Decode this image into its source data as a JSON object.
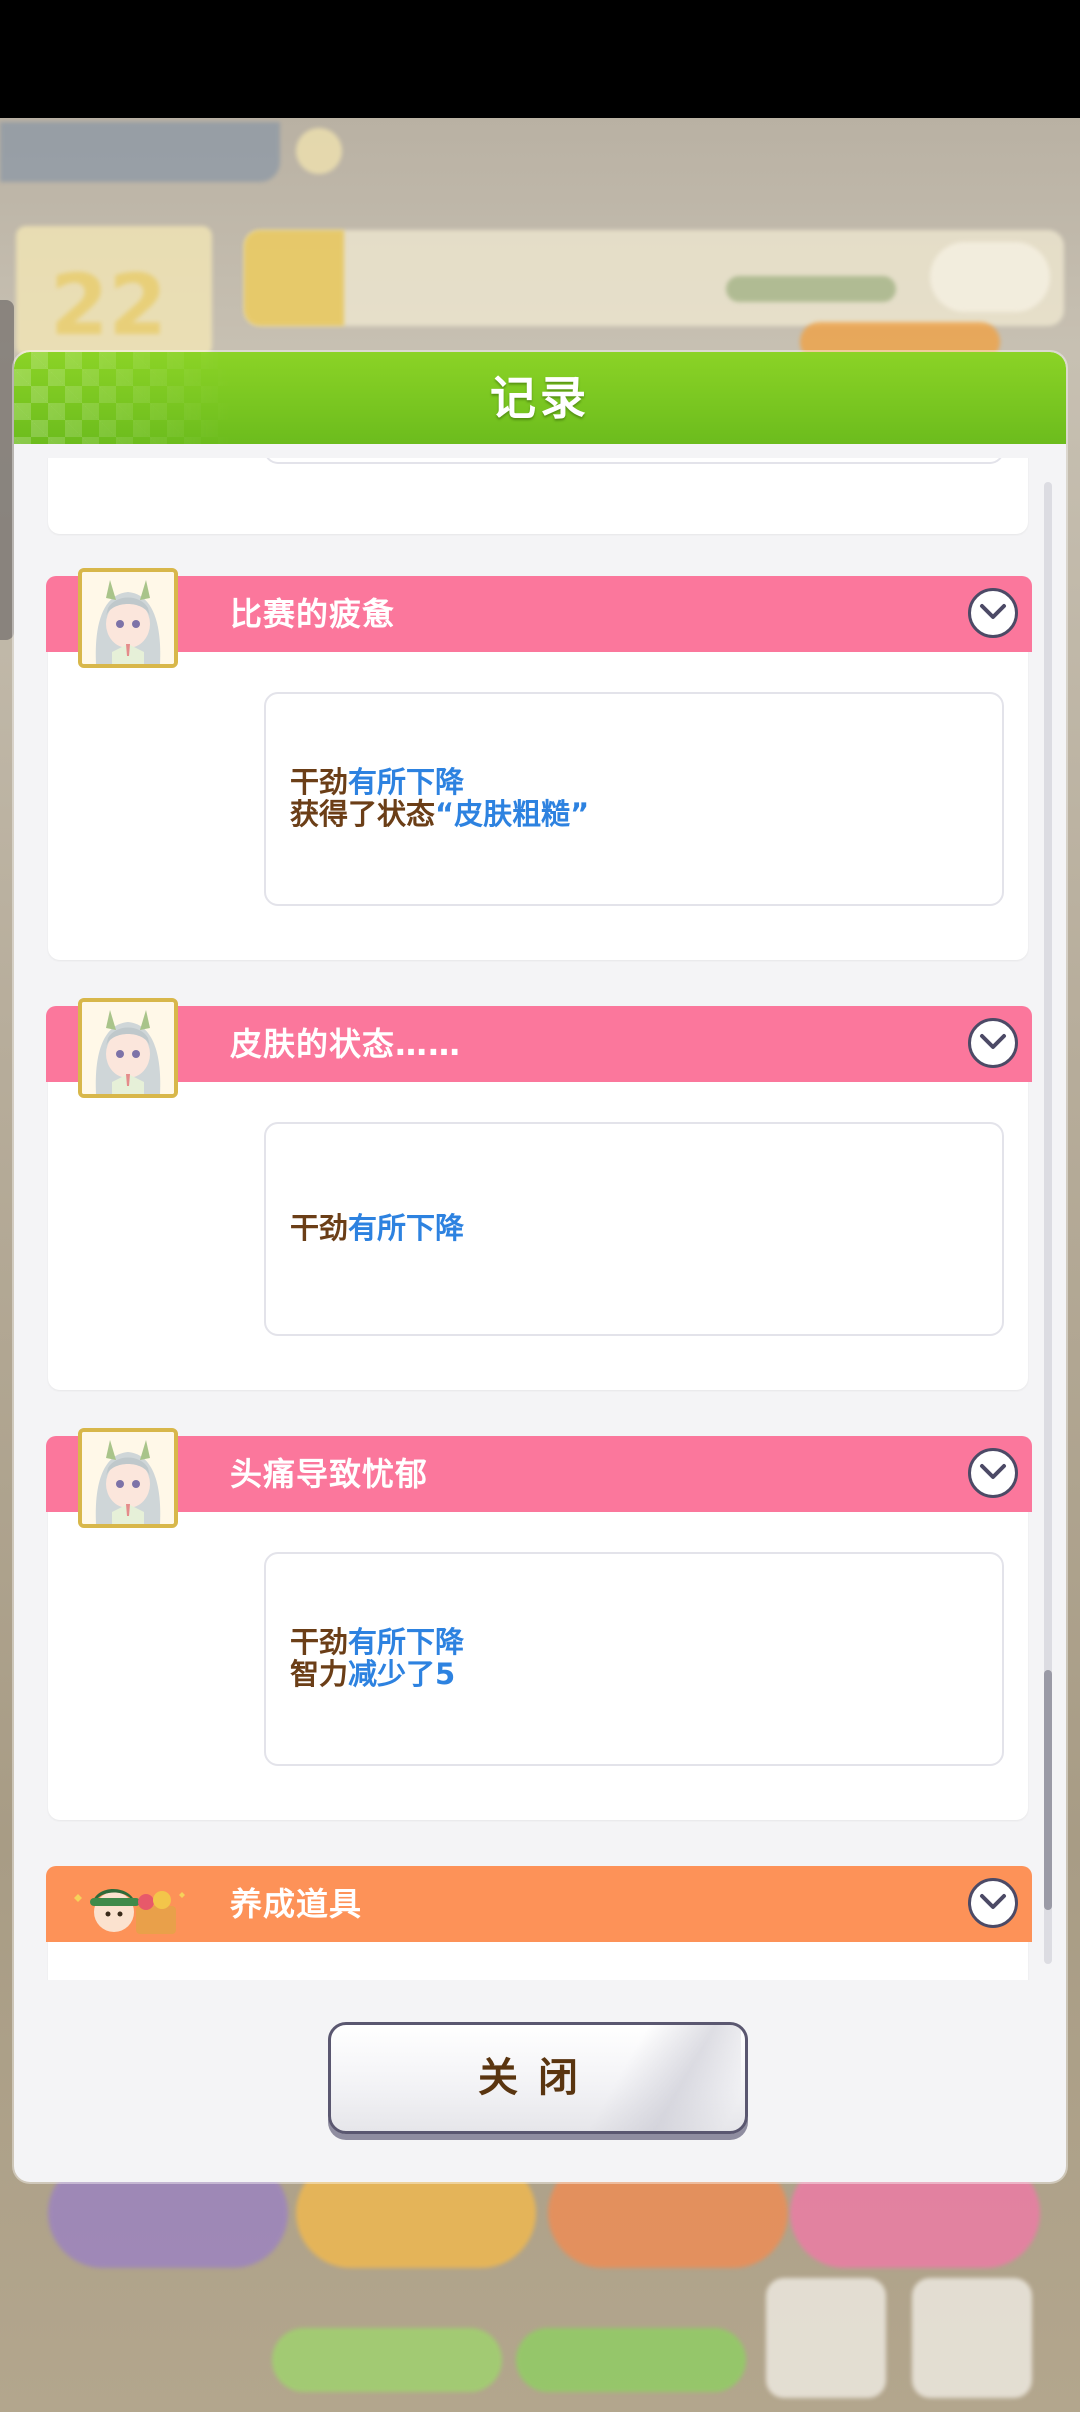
{
  "modal": {
    "title": "记录",
    "close_label": "关闭"
  },
  "background": {
    "day_number": "22"
  },
  "entries": [
    {
      "title": "比赛的疲惫",
      "lines": [
        {
          "a": "干劲",
          "b": "有所下降",
          "c": ""
        },
        {
          "a": "获得了状态",
          "b": "“皮肤粗糙”",
          "c": ""
        }
      ]
    },
    {
      "title": "皮肤的状态……",
      "lines": [
        {
          "a": "干劲",
          "b": "有所下降",
          "c": ""
        }
      ]
    },
    {
      "title": "头痛导致忧郁",
      "lines": [
        {
          "a": "干劲",
          "b": "有所下降",
          "c": ""
        },
        {
          "a": "智力",
          "b": "减少了5",
          "c": ""
        }
      ]
    },
    {
      "title": "养成道具"
    }
  ],
  "colors": {
    "header_green": "#7cc722",
    "bar_pink": "#fb779c",
    "bar_orange": "#fd9258",
    "text_brown": "#6b3e17",
    "text_blue": "#2d82e0"
  }
}
